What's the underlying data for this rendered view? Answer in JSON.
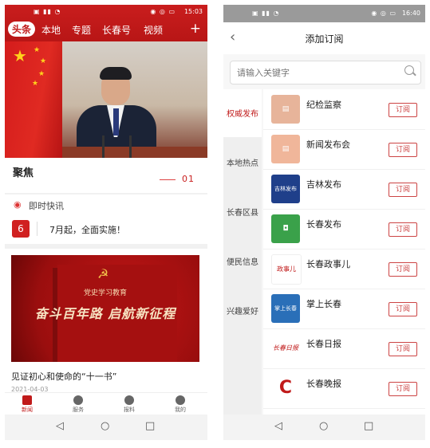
{
  "left_phone": {
    "status_time": "15:03",
    "tabs": [
      "头条",
      "本地",
      "专题",
      "长春号",
      "视频"
    ],
    "focus": {
      "title": "聚焦",
      "number": "01"
    },
    "quick_news": {
      "heading": "即时快讯",
      "logo_text": "6",
      "headline": "7月起，全面实施！"
    },
    "card": {
      "book_subtitle": "党史学习教育",
      "book_title": "奋斗百年路 启航新征程",
      "caption": "见证初心和使命的“十一书”",
      "date": "2021-04-03"
    },
    "bottom_nav": [
      "新闻",
      "服务",
      "报料",
      "我的"
    ]
  },
  "right_phone": {
    "status_time": "16:40",
    "title": "添加订阅",
    "search_placeholder": "请输入关键字",
    "categories": [
      "权威发布",
      "本地热点",
      "长春区县",
      "便民信息",
      "兴趣爱好"
    ],
    "subscribe_label": "订阅",
    "channels": [
      {
        "name": "纪检监察",
        "logo_color": "#e7b49a",
        "logo_text": ""
      },
      {
        "name": "新闻发布会",
        "logo_color": "#f0b69a",
        "logo_text": ""
      },
      {
        "name": "吉林发布",
        "logo_color": "#1f3f8a",
        "logo_text": "吉林发布"
      },
      {
        "name": "长春发布",
        "logo_color": "#3aa14a",
        "logo_text": ""
      },
      {
        "name": "长春政事儿",
        "logo_color": "#ffffff",
        "logo_text": "政事儿"
      },
      {
        "name": "掌上长春",
        "logo_color": "#2a6fb8",
        "logo_text": "掌上长春"
      },
      {
        "name": "长春日报",
        "logo_color": "#ffffff",
        "logo_text": "长春日报"
      },
      {
        "name": "长春晚报",
        "logo_color": "#ffffff",
        "logo_text": "C"
      }
    ]
  }
}
